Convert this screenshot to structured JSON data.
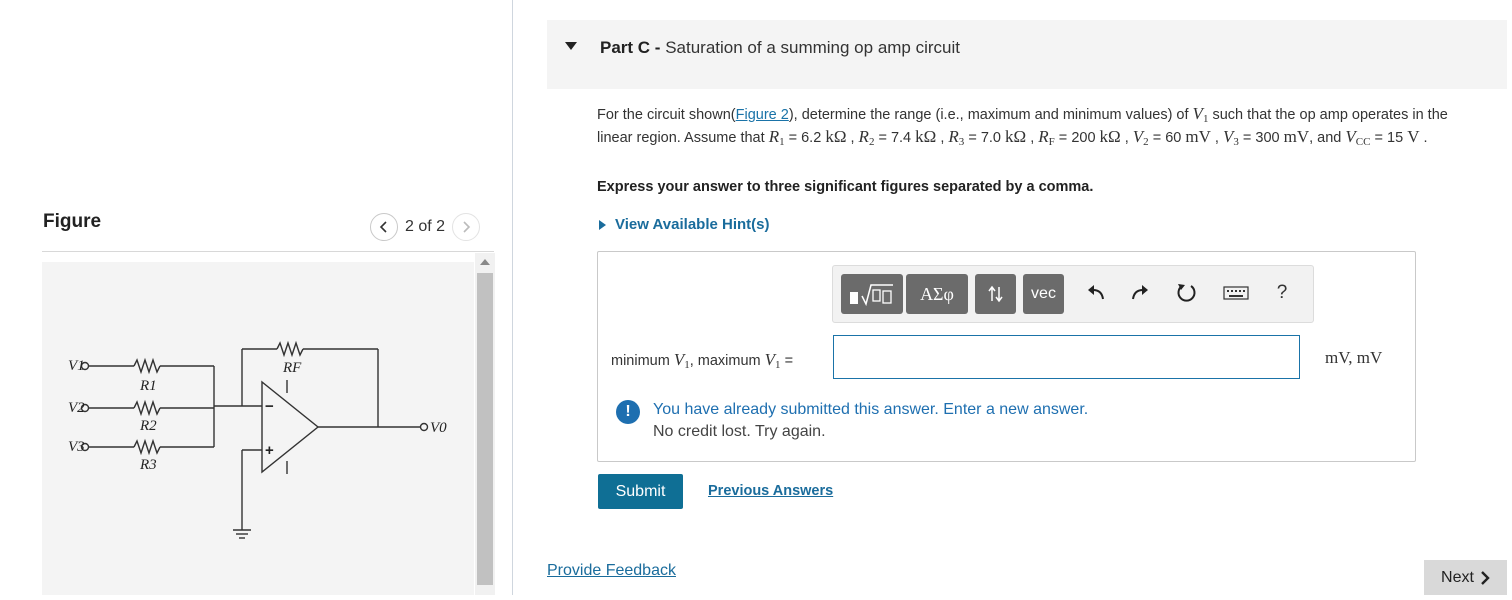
{
  "figure": {
    "title": "Figure",
    "counter": "2 of 2",
    "labels": {
      "v1": "V1",
      "v2": "V2",
      "v3": "V3",
      "vo": "V0",
      "r1": "R1",
      "r2": "R2",
      "r3": "R3",
      "rf": "RF",
      "minus": "−",
      "plus": "+"
    }
  },
  "part": {
    "prefix": "Part C -",
    "title": "Saturation of a summing op amp circuit"
  },
  "problem": {
    "t1": "For the circuit shown(",
    "link": "Figure 2",
    "t2": "), determine the range (i.e., maximum and minimum values) of ",
    "t3": " such that the op amp operates in the linear region. Assume that ",
    "r1_val": "6.2",
    "r2_val": "7.4",
    "r3_val": "7.0",
    "rf_val": "200",
    "v2_val": "60",
    "v3_val": "300",
    "vcc_val": "15",
    "kohm": "kΩ",
    "mv": "mV",
    "v": "V",
    "and": ", and ",
    "express": "Express your answer to three significant figures separated by a comma."
  },
  "hint": {
    "label": "View Available Hint(s)"
  },
  "toolbar": {
    "template_icon": "template-icon",
    "greek_label": "ΑΣφ",
    "arrows_icon": "updown-arrows-icon",
    "vec_label": "vec",
    "undo_icon": "undo-icon",
    "redo_icon": "redo-icon",
    "reset_icon": "reset-icon",
    "keyboard_icon": "keyboard-icon",
    "help_label": "?"
  },
  "answer": {
    "label_min": "minimum ",
    "label_max": ", maximum ",
    "label_eq": " =",
    "value": "",
    "units": "mV, mV"
  },
  "warning": {
    "line1": "You have already submitted this answer. Enter a new answer.",
    "line2": "No credit lost. Try again."
  },
  "buttons": {
    "submit": "Submit",
    "previous_answers": "Previous Answers",
    "provide_feedback": "Provide Feedback",
    "next": "Next"
  },
  "colors": {
    "accent": "#0f6f95",
    "link": "#1a6c9c",
    "warning": "#1e6fb0",
    "toolbar_button": "#6b6b6b"
  }
}
